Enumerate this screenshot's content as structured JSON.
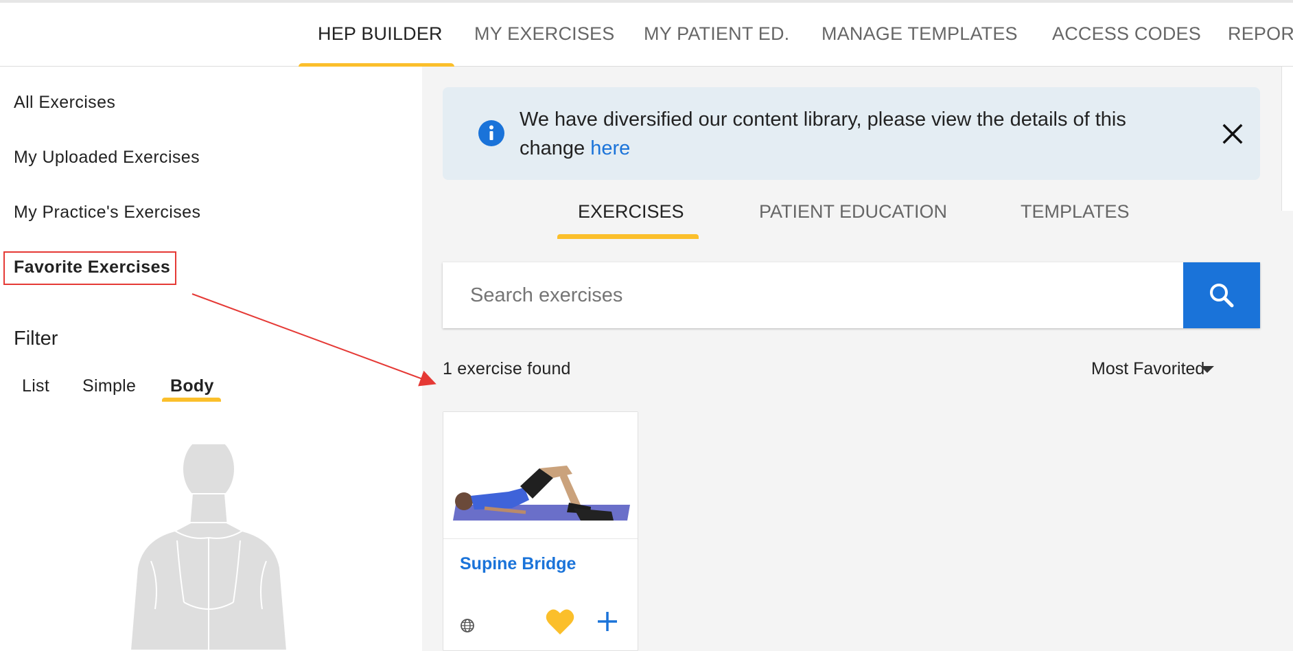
{
  "top_nav": {
    "items": [
      {
        "label": "HEP BUILDER",
        "active": true
      },
      {
        "label": "MY EXERCISES"
      },
      {
        "label": "MY PATIENT ED."
      },
      {
        "label": "MANAGE TEMPLATES"
      },
      {
        "label": "ACCESS CODES"
      },
      {
        "label": "REPORT"
      }
    ]
  },
  "sidebar": {
    "links": [
      {
        "label": "All Exercises"
      },
      {
        "label": "My Uploaded Exercises"
      },
      {
        "label": "My Practice's Exercises"
      },
      {
        "label": "Favorite Exercises",
        "selected": true
      }
    ],
    "filter": {
      "title": "Filter",
      "options": [
        "List",
        "Simple",
        "Body"
      ],
      "selected": "Body"
    }
  },
  "banner": {
    "text": "We have diversified our content library, please view the details of this change",
    "link_text": "here",
    "icon": "info-icon",
    "close_icon": "close-icon"
  },
  "subtabs": {
    "items": [
      "EXERCISES",
      "PATIENT EDUCATION",
      "TEMPLATES"
    ],
    "active": "EXERCISES"
  },
  "search": {
    "placeholder": "Search exercises",
    "value": "",
    "icon": "search-icon"
  },
  "results": {
    "count_text": "1 exercise found",
    "sort_label": "Most Favorited"
  },
  "cards": [
    {
      "title": "Supine Bridge",
      "favorited": true
    }
  ],
  "colors": {
    "accent_yellow": "#fbbf2b",
    "brand_blue": "#1a73d9",
    "annotation_red": "#e53935",
    "banner_bg": "#e4edf3"
  }
}
